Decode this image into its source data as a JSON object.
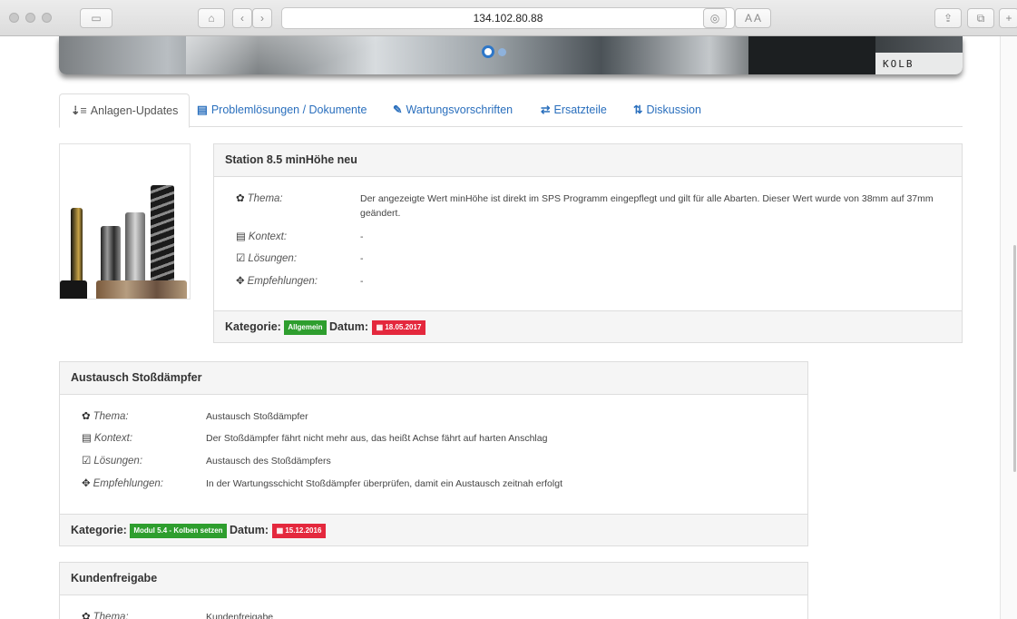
{
  "browser": {
    "url": "134.102.80.88",
    "reader_label": "A A"
  },
  "tabs": [
    {
      "icon": "⇣≡",
      "label": "Anlagen-Updates"
    },
    {
      "icon": "💾",
      "label": "Problemlösungen / Dokumente"
    },
    {
      "icon": "✎",
      "label": "Wartungsvorschriften"
    },
    {
      "icon": "⇄",
      "label": "Ersatzteile"
    },
    {
      "icon": "⇅",
      "label": "Diskussion"
    }
  ],
  "banner_text": "KOLB",
  "labels": {
    "thema": "Thema:",
    "kontext": "Kontext:",
    "loesungen": "Lösungen:",
    "empfehlungen": "Empfehlungen:",
    "kategorie": "Kategorie:",
    "datum": "Datum:"
  },
  "entries": [
    {
      "title": "Station 8.5 minHöhe neu",
      "thema": "Der angezeigte Wert minHöhe ist direkt im SPS Programm eingepflegt und gilt für alle Abarten. Dieser Wert wurde von 38mm auf 37mm geändert.",
      "kontext": "-",
      "loesungen": "-",
      "empfehlungen": "-",
      "kategorie": "Allgemein",
      "datum": "18.05.2017"
    },
    {
      "title": "Austausch Stoßdämpfer",
      "thema": "Austausch Stoßdämpfer",
      "kontext": "Der Stoßdämpfer fährt nicht mehr aus, das heißt Achse fährt auf harten Anschlag",
      "loesungen": "Austausch des Stoßdämpfers",
      "empfehlungen": "In der Wartungsschicht Stoßdämpfer überprüfen, damit ein Austausch zeitnah erfolgt",
      "kategorie": "Modul 5.4 - Kolben setzen",
      "datum": "15.12.2016"
    },
    {
      "title": "Kundenfreigabe",
      "thema": "Kundenfreigabe"
    }
  ],
  "colors": {
    "link": "#2a6fbd",
    "badge_green": "#2e9e2e",
    "badge_red": "#e4283d"
  }
}
